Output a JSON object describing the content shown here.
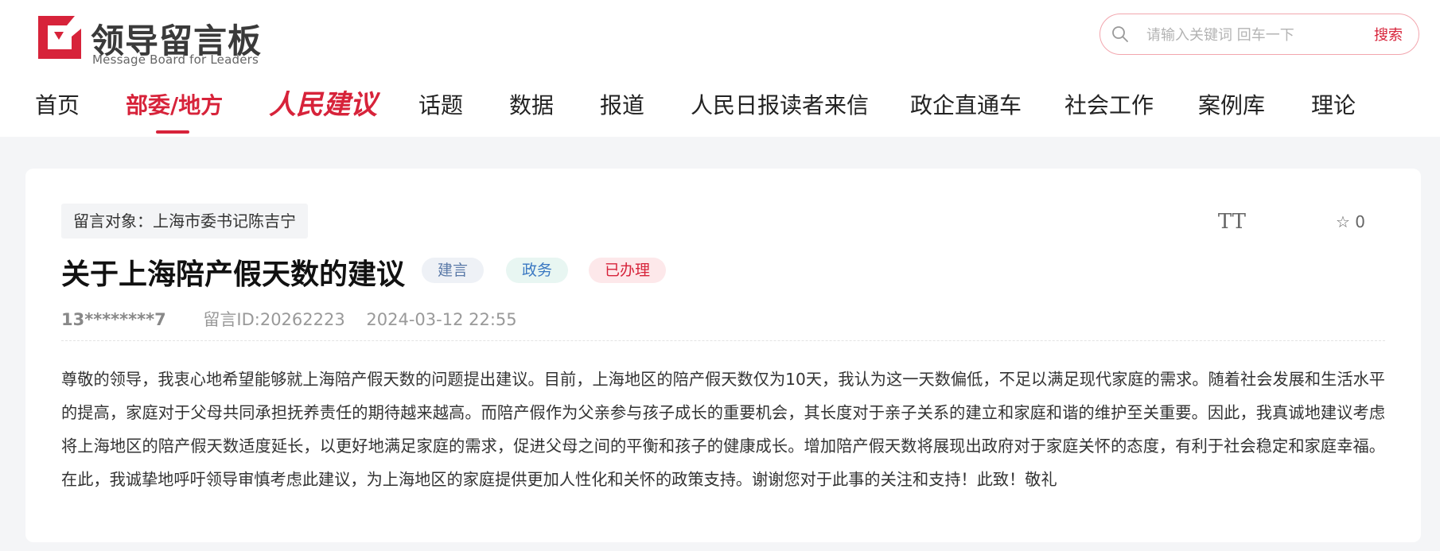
{
  "header": {
    "logo_title": "领导留言板",
    "logo_subtitle": "Message Board for Leaders",
    "colors": {
      "brand": "#d7233a"
    }
  },
  "search": {
    "placeholder": "请输入关键词 回车一下",
    "button_label": "搜索",
    "icon": "search-icon"
  },
  "nav": {
    "items": [
      {
        "label": "首页"
      },
      {
        "label": "部委/地方",
        "active": true
      },
      {
        "label": "人民建议"
      },
      {
        "label": "话题"
      },
      {
        "label": "数据"
      },
      {
        "label": "报道"
      },
      {
        "label": "人民日报读者来信"
      },
      {
        "label": "政企直通车"
      },
      {
        "label": "社会工作"
      },
      {
        "label": "案例库"
      },
      {
        "label": "理论"
      }
    ]
  },
  "message": {
    "target": "留言对象：上海市委书记陈吉宁",
    "title": "关于上海陪产假天数的建议",
    "tags": [
      "建言",
      "政务",
      "已办理"
    ],
    "user": "13********7",
    "id_label": "留言ID:20262223",
    "datetime": "2024-03-12 22:55",
    "font_tool_label": "TT",
    "favorite_count": "0",
    "body": "尊敬的领导，我衷心地希望能够就上海陪产假天数的问题提出建议。目前，上海地区的陪产假天数仅为10天，我认为这一天数偏低，不足以满足现代家庭的需求。随着社会发展和生活水平的提高，家庭对于父母共同承担抚养责任的期待越来越高。而陪产假作为父亲参与孩子成长的重要机会，其长度对于亲子关系的建立和家庭和谐的维护至关重要。因此，我真诚地建议考虑将上海地区的陪产假天数适度延长，以更好地满足家庭的需求，促进父母之间的平衡和孩子的健康成长。增加陪产假天数将展现出政府对于家庭关怀的态度，有利于社会稳定和家庭幸福。在此，我诚挚地呼吁领导审慎考虑此建议，为上海地区的家庭提供更加人性化和关怀的政策支持。谢谢您对于此事的关注和支持！此致！敬礼"
  }
}
